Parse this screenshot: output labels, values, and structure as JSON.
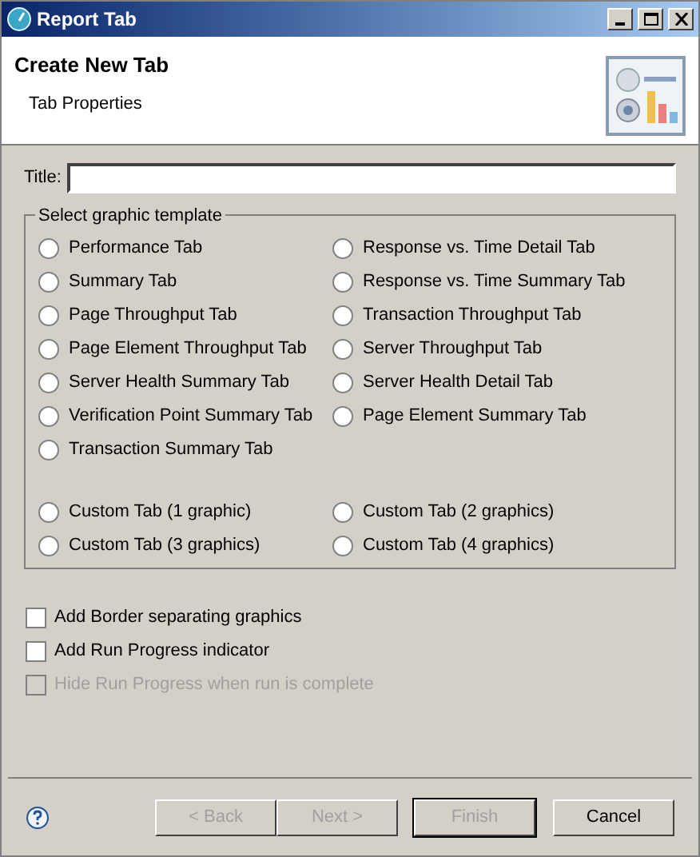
{
  "window": {
    "title": "Report Tab"
  },
  "header": {
    "title": "Create New Tab",
    "subtitle": "Tab Properties"
  },
  "title_field": {
    "label": "Title:"
  },
  "template_group": {
    "legend": "Select graphic template",
    "columns": [
      [
        {
          "label": "Performance Tab",
          "selected": false
        },
        {
          "label": "Summary Tab",
          "selected": false
        },
        {
          "label": "Page Throughput Tab",
          "selected": false
        },
        {
          "label": "Page Element Throughput Tab",
          "selected": false
        },
        {
          "label": "Server Health Summary Tab",
          "selected": false
        },
        {
          "label": "Verification Point Summary Tab",
          "selected": false
        },
        {
          "label": "Transaction Summary Tab",
          "selected": false
        }
      ],
      [
        {
          "label": "Response vs. Time Detail Tab",
          "selected": false
        },
        {
          "label": "Response vs. Time Summary Tab",
          "selected": false
        },
        {
          "label": "Transaction Throughput Tab",
          "selected": false
        },
        {
          "label": "Server Throughput Tab",
          "selected": false
        },
        {
          "label": "Server Health Detail Tab",
          "selected": false
        },
        {
          "label": "Page Element Summary Tab",
          "selected": false
        }
      ]
    ],
    "custom_columns": [
      [
        {
          "label": "Custom Tab (1 graphic)",
          "selected": false
        },
        {
          "label": "Custom Tab (3 graphics)",
          "selected": false
        }
      ],
      [
        {
          "label": "Custom Tab (2 graphics)",
          "selected": false
        },
        {
          "label": "Custom Tab (4 graphics)",
          "selected": false
        }
      ]
    ]
  },
  "options": [
    {
      "label": "Add Border separating graphics",
      "checked": false,
      "disabled": false
    },
    {
      "label": "Add Run Progress indicator",
      "checked": false,
      "disabled": false
    },
    {
      "label": "Hide Run Progress when run is complete",
      "checked": false,
      "disabled": true
    }
  ],
  "buttons": [
    {
      "label": "< Back",
      "disabled": true,
      "default": false
    },
    {
      "label": "Next >",
      "disabled": true,
      "default": false
    },
    {
      "label": "Finish",
      "disabled": true,
      "default": true
    },
    {
      "label": "Cancel",
      "disabled": false,
      "default": false
    }
  ]
}
